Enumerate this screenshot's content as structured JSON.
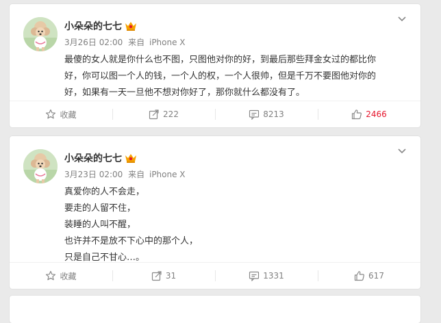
{
  "colors": {
    "page_background": "#eaeaea",
    "card_background": "#ffffff",
    "text_primary": "#333333",
    "text_meta": "#808080",
    "like_highlight": "#e6162d",
    "vip_badge": "#f5a300"
  },
  "posts": [
    {
      "user_name": "小朵朵的七七",
      "date": "3月26日 02:00",
      "via": "来自",
      "device": "iPhone X",
      "text_lines": [
        "最傻的女人就是你什么也不图，只图他对你的好，到最后那些拜金女过的都比你",
        "好，你可以图一个人的钱，一个人的权，一个人很帅，但是千万不要图他对你的",
        "好，如果有一天一旦他不想对你好了，那你就什么都没有了。"
      ],
      "actions": {
        "favorite_label": "收藏",
        "repost_count": "222",
        "comment_count": "8213",
        "like_count": "2466"
      },
      "like_active": true
    },
    {
      "user_name": "小朵朵的七七",
      "date": "3月23日 02:00",
      "via": "来自",
      "device": "iPhone X",
      "text_lines": [
        "真爱你的人不会走，",
        "要走的人留不住，",
        "装睡的人叫不醒，",
        "也许并不是放不下心中的那个人，",
        "只是自己不甘心…。"
      ],
      "actions": {
        "favorite_label": "收藏",
        "repost_count": "31",
        "comment_count": "1331",
        "like_count": "617"
      },
      "like_active": false
    }
  ],
  "icons": {
    "menu": "chevron-down-icon",
    "vip": "vip-badge-icon",
    "favorite": "star-icon",
    "repost": "repost-icon",
    "comment": "comment-icon",
    "like": "thumbs-up-icon"
  }
}
